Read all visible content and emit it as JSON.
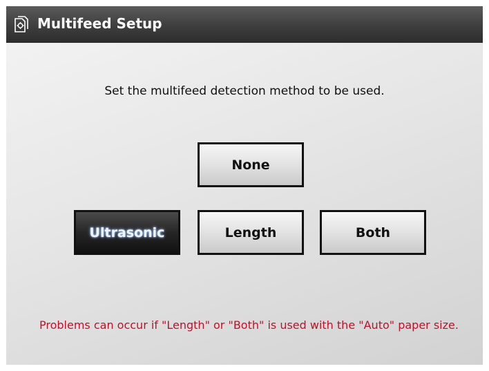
{
  "header": {
    "title": "Multifeed Setup",
    "icon": "settings-document-icon"
  },
  "instruction": "Set the multifeed detection method to be used.",
  "options": {
    "none": "None",
    "ultrasonic": "Ultrasonic",
    "length": "Length",
    "both": "Both"
  },
  "selected_option": "Ultrasonic",
  "warning": "Problems can occur if \"Length\" or \"Both\" is used with the \"Auto\" paper size.",
  "colors": {
    "title_bar": "#3e3e3e",
    "selected_button": "#1a1a1a",
    "warning_text": "#c2102a"
  }
}
